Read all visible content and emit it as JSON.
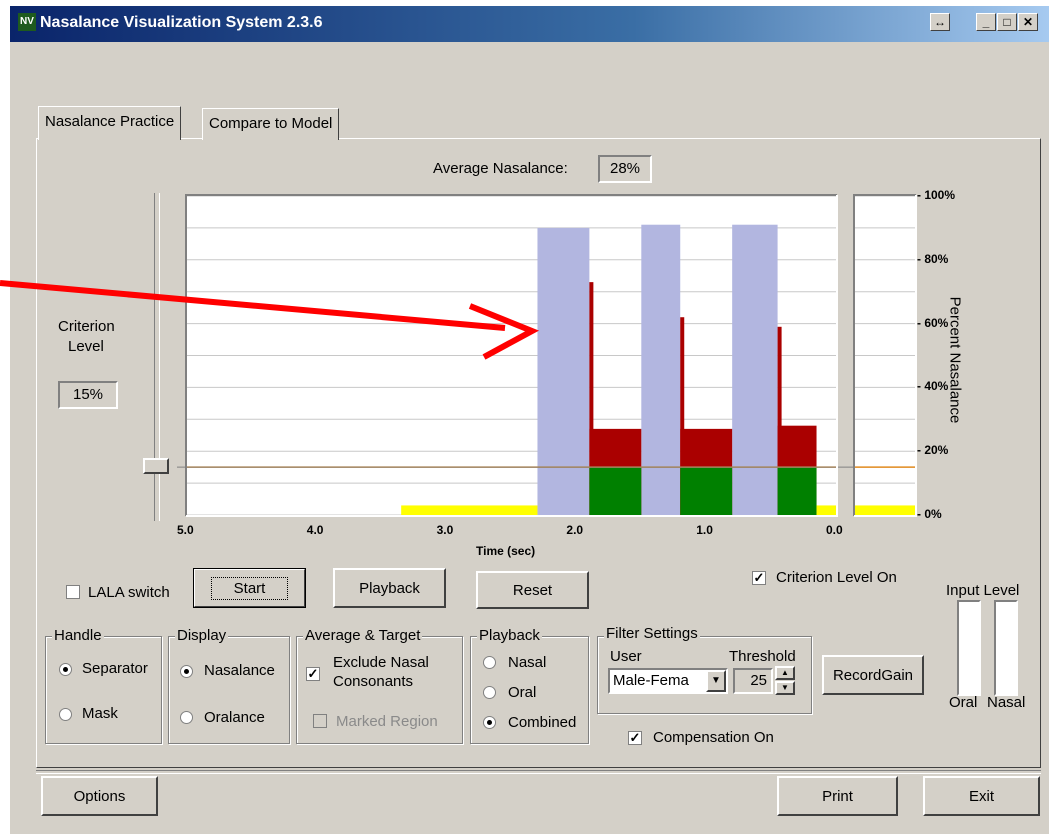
{
  "window": {
    "title": "Nasalance Visualization System 2.3.6"
  },
  "tabs": [
    {
      "label": "Nasalance Practice",
      "active": true
    },
    {
      "label": "Compare to Model",
      "active": false
    }
  ],
  "average_nasalance": {
    "label": "Average Nasalance:",
    "value": "28%"
  },
  "criterion": {
    "label_line1": "Criterion",
    "label_line2": "Level",
    "value": "15%"
  },
  "chart": {
    "x_ticks": [
      "5.0",
      "4.0",
      "3.0",
      "2.0",
      "1.0",
      "0.0"
    ],
    "xlabel": "Time (sec)",
    "y_ticks": [
      "100%",
      "80%",
      "60%",
      "40%",
      "20%",
      "0%"
    ],
    "ylabel": "Percent Nasalance"
  },
  "chart_data": {
    "type": "area",
    "xlabel": "Time (sec)",
    "ylabel": "Percent Nasalance",
    "xlim": [
      5.0,
      0.0
    ],
    "ylim": [
      0,
      100
    ],
    "criterion_line": 15,
    "grid": true,
    "series": [
      {
        "color": "#b2b6e0",
        "segments": [
          {
            "from": 2.3,
            "to": 1.9,
            "y": 90
          },
          {
            "from": 1.5,
            "to": 1.2,
            "y": 91
          },
          {
            "from": 0.8,
            "to": 0.45,
            "y": 91
          }
        ]
      },
      {
        "color": "#aa0000",
        "segments": [
          {
            "from": 1.9,
            "to": 1.5,
            "y": 27,
            "spike": 73
          },
          {
            "from": 1.2,
            "to": 0.8,
            "y": 27,
            "spike": 62
          },
          {
            "from": 0.45,
            "to": 0.15,
            "y": 28,
            "spike": 59
          }
        ]
      },
      {
        "color": "#008000",
        "segments": [
          {
            "from": 1.9,
            "to": 1.5,
            "y": 15
          },
          {
            "from": 1.2,
            "to": 0.8,
            "y": 15
          },
          {
            "from": 0.45,
            "to": 0.15,
            "y": 15
          }
        ]
      },
      {
        "color": "#ffff00",
        "segments": [
          {
            "from": 3.35,
            "to": 2.3,
            "y": 3
          },
          {
            "from": 0.15,
            "to": 0.0,
            "y": 3
          }
        ]
      }
    ],
    "side_bar": {
      "value": 3,
      "color": "#ffff00"
    }
  },
  "controls": {
    "lala_label": "LALA switch",
    "start_label": "Start",
    "playback_label": "Playback",
    "reset_label": "Reset",
    "criterion_on_label": "Criterion Level On",
    "input_level_label": "Input Level",
    "oral_label": "Oral",
    "nasal_label": "Nasal"
  },
  "handle_group": {
    "title": "Handle",
    "options": [
      "Separator",
      "Mask"
    ],
    "selected": "Separator"
  },
  "display_group": {
    "title": "Display",
    "options": [
      "Nasalance",
      "Oralance"
    ],
    "selected": "Nasalance"
  },
  "average_group": {
    "title": "Average & Target",
    "exclude_line1": "Exclude Nasal",
    "exclude_line2": "Consonants",
    "marked_label": "Marked Region"
  },
  "playback_group": {
    "title": "Playback",
    "options": [
      "Nasal",
      "Oral",
      "Combined"
    ],
    "selected": "Combined"
  },
  "filter_group": {
    "title": "Filter Settings",
    "user_label": "User",
    "threshold_label": "Threshold",
    "user_value": "Male-Fema",
    "threshold_value": "25"
  },
  "record_gain_label": "RecordGain",
  "compensation_label": "Compensation On",
  "footer": {
    "options_label": "Options",
    "print_label": "Print",
    "exit_label": "Exit"
  }
}
